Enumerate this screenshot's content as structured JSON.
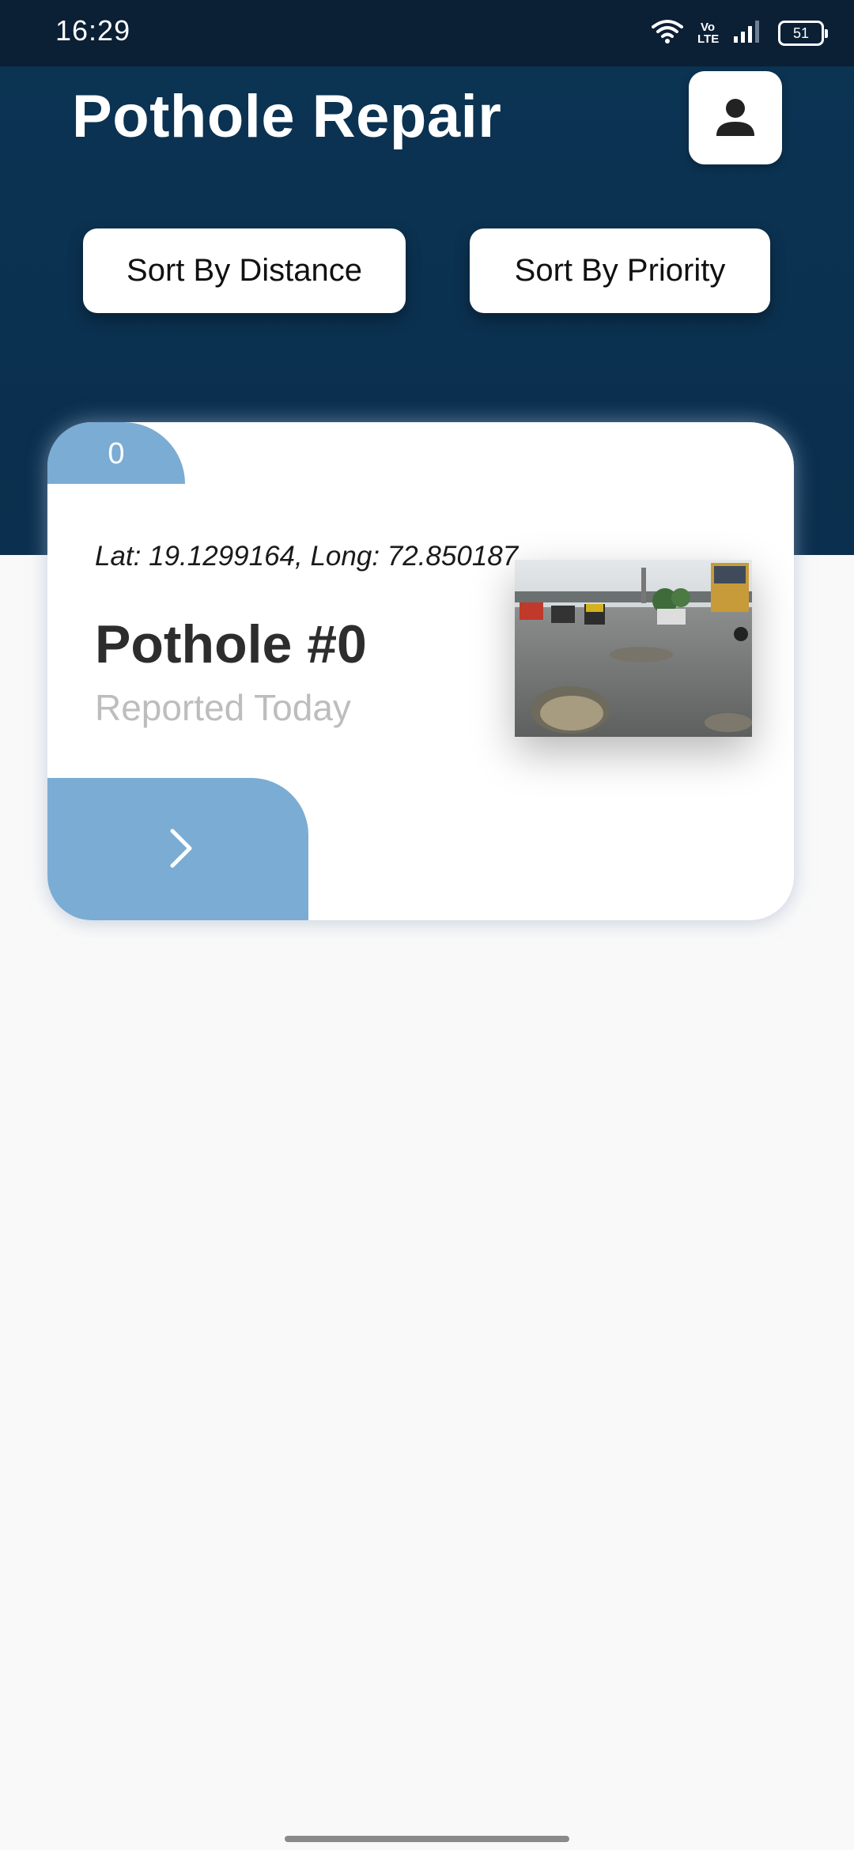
{
  "status_bar": {
    "time": "16:29",
    "network_label": "Vo LTE",
    "battery_level": "51"
  },
  "header": {
    "title": "Pothole Repair",
    "profile_icon": "person-icon",
    "sort_distance_label": "Sort By Distance",
    "sort_priority_label": "Sort By Priority"
  },
  "cards": [
    {
      "rank": "0",
      "coordinates": "Lat: 19.1299164, Long: 72.850187",
      "title": "Pothole #0",
      "reported": "Reported Today",
      "open_icon": "chevron-right-icon"
    }
  ],
  "colors": {
    "header_bg": "#0b3352",
    "status_bar_bg": "#0b1f35",
    "accent": "#7aacd4",
    "background": "#f9f9f9",
    "subtle_text": "#bdbdbd"
  }
}
